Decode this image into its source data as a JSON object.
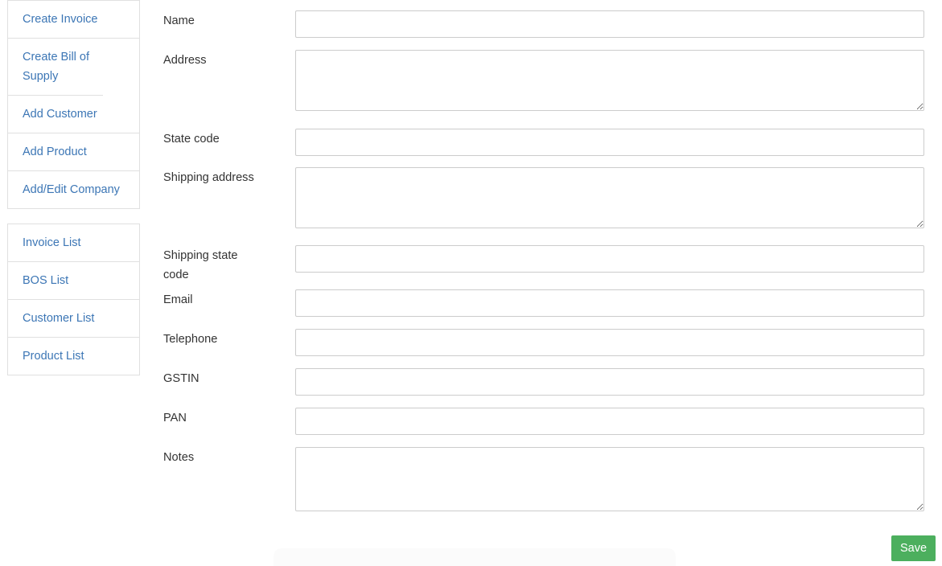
{
  "sidebar": {
    "groups": [
      {
        "name": "actions",
        "items": [
          {
            "label": "Create Invoice",
            "key": "create-invoice"
          },
          {
            "label": "Create Bill of Supply",
            "key": "create-bill-of-supply"
          },
          {
            "label": "Add Customer",
            "key": "add-customer"
          },
          {
            "label": "Add Product",
            "key": "add-product"
          },
          {
            "label": "Add/Edit Company",
            "key": "add-edit-company"
          }
        ]
      },
      {
        "name": "lists",
        "items": [
          {
            "label": "Invoice List",
            "key": "invoice-list"
          },
          {
            "label": "BOS List",
            "key": "bos-list"
          },
          {
            "label": "Customer List",
            "key": "customer-list"
          },
          {
            "label": "Product List",
            "key": "product-list"
          }
        ]
      }
    ]
  },
  "form": {
    "fields": [
      {
        "key": "name",
        "label": "Name",
        "type": "input",
        "value": "",
        "placeholder": ""
      },
      {
        "key": "address",
        "label": "Address",
        "type": "textarea",
        "value": "",
        "placeholder": ""
      },
      {
        "key": "state_code",
        "label": "State code",
        "type": "input",
        "value": "",
        "placeholder": ""
      },
      {
        "key": "shipping_address",
        "label": "Shipping address",
        "type": "textarea",
        "value": "",
        "placeholder": ""
      },
      {
        "key": "shipping_state_code",
        "label": "Shipping state code",
        "type": "input",
        "value": "",
        "placeholder": ""
      },
      {
        "key": "email",
        "label": "Email",
        "type": "input",
        "value": "",
        "placeholder": ""
      },
      {
        "key": "telephone",
        "label": "Telephone",
        "type": "input",
        "value": "",
        "placeholder": ""
      },
      {
        "key": "gstin",
        "label": "GSTIN",
        "type": "input",
        "value": "",
        "placeholder": ""
      },
      {
        "key": "pan",
        "label": "PAN",
        "type": "input",
        "value": "",
        "placeholder": ""
      },
      {
        "key": "notes",
        "label": "Notes",
        "type": "textarea",
        "value": "",
        "placeholder": ""
      }
    ],
    "save_label": "Save"
  },
  "colors": {
    "link": "#3c76b5",
    "label": "#333333",
    "border": "#cccccc",
    "group_border": "#e0e0e0",
    "save_bg": "#4caf5e",
    "save_text": "#ffffff"
  }
}
